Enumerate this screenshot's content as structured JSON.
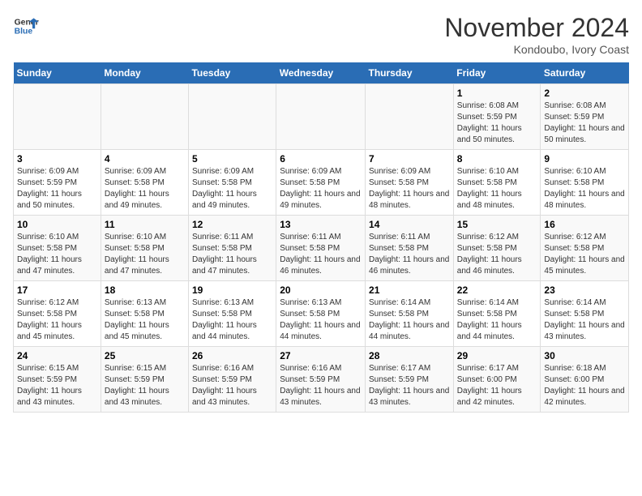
{
  "header": {
    "logo_line1": "General",
    "logo_line2": "Blue",
    "month_title": "November 2024",
    "location": "Kondoubo, Ivory Coast"
  },
  "weekdays": [
    "Sunday",
    "Monday",
    "Tuesday",
    "Wednesday",
    "Thursday",
    "Friday",
    "Saturday"
  ],
  "weeks": [
    [
      {
        "day": "",
        "info": ""
      },
      {
        "day": "",
        "info": ""
      },
      {
        "day": "",
        "info": ""
      },
      {
        "day": "",
        "info": ""
      },
      {
        "day": "",
        "info": ""
      },
      {
        "day": "1",
        "info": "Sunrise: 6:08 AM\nSunset: 5:59 PM\nDaylight: 11 hours and 50 minutes."
      },
      {
        "day": "2",
        "info": "Sunrise: 6:08 AM\nSunset: 5:59 PM\nDaylight: 11 hours and 50 minutes."
      }
    ],
    [
      {
        "day": "3",
        "info": "Sunrise: 6:09 AM\nSunset: 5:59 PM\nDaylight: 11 hours and 50 minutes."
      },
      {
        "day": "4",
        "info": "Sunrise: 6:09 AM\nSunset: 5:58 PM\nDaylight: 11 hours and 49 minutes."
      },
      {
        "day": "5",
        "info": "Sunrise: 6:09 AM\nSunset: 5:58 PM\nDaylight: 11 hours and 49 minutes."
      },
      {
        "day": "6",
        "info": "Sunrise: 6:09 AM\nSunset: 5:58 PM\nDaylight: 11 hours and 49 minutes."
      },
      {
        "day": "7",
        "info": "Sunrise: 6:09 AM\nSunset: 5:58 PM\nDaylight: 11 hours and 48 minutes."
      },
      {
        "day": "8",
        "info": "Sunrise: 6:10 AM\nSunset: 5:58 PM\nDaylight: 11 hours and 48 minutes."
      },
      {
        "day": "9",
        "info": "Sunrise: 6:10 AM\nSunset: 5:58 PM\nDaylight: 11 hours and 48 minutes."
      }
    ],
    [
      {
        "day": "10",
        "info": "Sunrise: 6:10 AM\nSunset: 5:58 PM\nDaylight: 11 hours and 47 minutes."
      },
      {
        "day": "11",
        "info": "Sunrise: 6:10 AM\nSunset: 5:58 PM\nDaylight: 11 hours and 47 minutes."
      },
      {
        "day": "12",
        "info": "Sunrise: 6:11 AM\nSunset: 5:58 PM\nDaylight: 11 hours and 47 minutes."
      },
      {
        "day": "13",
        "info": "Sunrise: 6:11 AM\nSunset: 5:58 PM\nDaylight: 11 hours and 46 minutes."
      },
      {
        "day": "14",
        "info": "Sunrise: 6:11 AM\nSunset: 5:58 PM\nDaylight: 11 hours and 46 minutes."
      },
      {
        "day": "15",
        "info": "Sunrise: 6:12 AM\nSunset: 5:58 PM\nDaylight: 11 hours and 46 minutes."
      },
      {
        "day": "16",
        "info": "Sunrise: 6:12 AM\nSunset: 5:58 PM\nDaylight: 11 hours and 45 minutes."
      }
    ],
    [
      {
        "day": "17",
        "info": "Sunrise: 6:12 AM\nSunset: 5:58 PM\nDaylight: 11 hours and 45 minutes."
      },
      {
        "day": "18",
        "info": "Sunrise: 6:13 AM\nSunset: 5:58 PM\nDaylight: 11 hours and 45 minutes."
      },
      {
        "day": "19",
        "info": "Sunrise: 6:13 AM\nSunset: 5:58 PM\nDaylight: 11 hours and 44 minutes."
      },
      {
        "day": "20",
        "info": "Sunrise: 6:13 AM\nSunset: 5:58 PM\nDaylight: 11 hours and 44 minutes."
      },
      {
        "day": "21",
        "info": "Sunrise: 6:14 AM\nSunset: 5:58 PM\nDaylight: 11 hours and 44 minutes."
      },
      {
        "day": "22",
        "info": "Sunrise: 6:14 AM\nSunset: 5:58 PM\nDaylight: 11 hours and 44 minutes."
      },
      {
        "day": "23",
        "info": "Sunrise: 6:14 AM\nSunset: 5:58 PM\nDaylight: 11 hours and 43 minutes."
      }
    ],
    [
      {
        "day": "24",
        "info": "Sunrise: 6:15 AM\nSunset: 5:59 PM\nDaylight: 11 hours and 43 minutes."
      },
      {
        "day": "25",
        "info": "Sunrise: 6:15 AM\nSunset: 5:59 PM\nDaylight: 11 hours and 43 minutes."
      },
      {
        "day": "26",
        "info": "Sunrise: 6:16 AM\nSunset: 5:59 PM\nDaylight: 11 hours and 43 minutes."
      },
      {
        "day": "27",
        "info": "Sunrise: 6:16 AM\nSunset: 5:59 PM\nDaylight: 11 hours and 43 minutes."
      },
      {
        "day": "28",
        "info": "Sunrise: 6:17 AM\nSunset: 5:59 PM\nDaylight: 11 hours and 43 minutes."
      },
      {
        "day": "29",
        "info": "Sunrise: 6:17 AM\nSunset: 6:00 PM\nDaylight: 11 hours and 42 minutes."
      },
      {
        "day": "30",
        "info": "Sunrise: 6:18 AM\nSunset: 6:00 PM\nDaylight: 11 hours and 42 minutes."
      }
    ]
  ]
}
